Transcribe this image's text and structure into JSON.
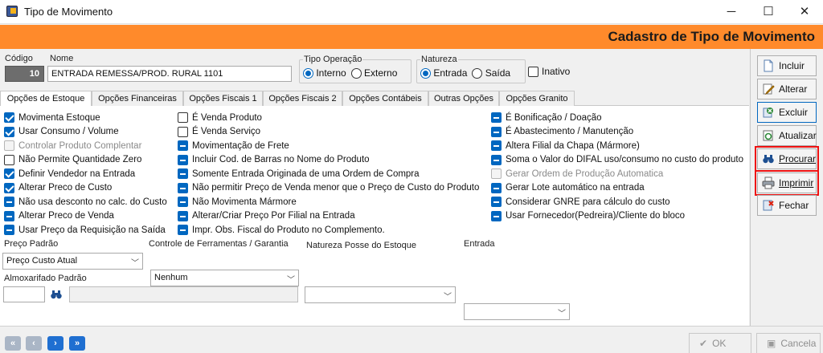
{
  "window": {
    "title": "Tipo de Movimento",
    "minimize": "─",
    "maximize": "☐",
    "close": "✕"
  },
  "banner": {
    "title": "Cadastro de Tipo de Movimento",
    "color": "#ff8a2b"
  },
  "header": {
    "codigo_label": "Código",
    "codigo_value": "10",
    "nome_label": "Nome",
    "nome_value": "ENTRADA REMESSA/PROD. RURAL 1101",
    "tipo_operacao_label": "Tipo Operação",
    "tipo_operacao_options": [
      "Interno",
      "Externo"
    ],
    "tipo_operacao_selected": "Interno",
    "natureza_label": "Natureza",
    "natureza_options": [
      "Entrada",
      "Saída"
    ],
    "natureza_selected": "Entrada",
    "inativo_label": "Inativo"
  },
  "tabs": [
    "Opções de Estoque",
    "Opções Financeiras",
    "Opções Fiscais 1",
    "Opções Fiscais 2",
    "Opções Contábeis",
    "Outras Opções",
    "Opções Granito"
  ],
  "active_tab": "Opções de Estoque",
  "options": {
    "col1": [
      {
        "label": "Movimenta Estoque",
        "state": "checked"
      },
      {
        "label": "Usar Consumo / Volume",
        "state": "checked"
      },
      {
        "label": "Controlar Produto Complentar",
        "state": "disabled"
      },
      {
        "label": "Não Permite Quantidade Zero",
        "state": "unchecked"
      },
      {
        "label": "Definir Vendedor na Entrada",
        "state": "checked"
      },
      {
        "label": "Alterar Preco de Custo",
        "state": "checked"
      },
      {
        "label": "Não usa desconto no calc. do Custo",
        "state": "indeterminate"
      },
      {
        "label": "Alterar Preco de Venda",
        "state": "indeterminate"
      },
      {
        "label": "Usar Preço da Requisição na Saída",
        "state": "indeterminate"
      }
    ],
    "col2": [
      {
        "label": "É Venda Produto",
        "state": "unchecked"
      },
      {
        "label": "É Venda Serviço",
        "state": "unchecked"
      },
      {
        "label": "Movimentação de Frete",
        "state": "indeterminate"
      },
      {
        "label": "Incluir Cod. de Barras no Nome do Produto",
        "state": "indeterminate"
      },
      {
        "label": "Somente Entrada Originada de uma Ordem de Compra",
        "state": "indeterminate"
      },
      {
        "label": "Não permitir Preço de Venda menor que o Preço de Custo do Produto",
        "state": "indeterminate"
      },
      {
        "label": "Não Movimenta Mármore",
        "state": "indeterminate"
      },
      {
        "label": "Alterar/Criar Preço Por Filial na Entrada",
        "state": "indeterminate"
      },
      {
        "label": "Impr. Obs. Fiscal do Produto no Complemento.",
        "state": "indeterminate"
      }
    ],
    "col3": [
      {
        "label": "É Bonificação / Doação",
        "state": "indeterminate"
      },
      {
        "label": "É Abastecimento / Manutenção",
        "state": "indeterminate"
      },
      {
        "label": "Altera Filial da Chapa (Mármore)",
        "state": "indeterminate"
      },
      {
        "label": "Soma o Valor do DIFAL uso/consumo no custo do produto",
        "state": "indeterminate"
      },
      {
        "label": "Gerar Ordem de Produção Automatica",
        "state": "disabled"
      },
      {
        "label": "Gerar Lote automático na entrada",
        "state": "indeterminate"
      },
      {
        "label": "Considerar GNRE para cálculo do custo",
        "state": "indeterminate"
      },
      {
        "label": "Usar Fornecedor(Pedreira)/Cliente do bloco",
        "state": "indeterminate"
      }
    ]
  },
  "combos": {
    "preco_padrao_label": "Preço Padrão",
    "preco_padrao_value": "Preço Custo Atual",
    "controle_label": "Controle de Ferramentas / Garantia",
    "controle_value": "Nenhum",
    "natureza_posse_label": "Natureza Posse do Estoque",
    "natureza_posse_value": "",
    "entrada_label": "Entrada",
    "entrada_value": ""
  },
  "almoxarifado": {
    "label": "Almoxarifado Padrão",
    "code": "",
    "name": ""
  },
  "sidebar": [
    {
      "label": "Incluir",
      "icon": "document-new-icon"
    },
    {
      "label": "Alterar",
      "icon": "edit-pencil-icon"
    },
    {
      "label": "Excluir",
      "icon": "delete-icon"
    },
    {
      "label": "Atualizar",
      "icon": "refresh-icon"
    },
    {
      "label": "Procurar",
      "icon": "binoculars-icon"
    },
    {
      "label": "Imprimir",
      "icon": "printer-icon"
    },
    {
      "label": "Fechar",
      "icon": "close-door-icon"
    }
  ],
  "footer": {
    "ok_label": "OK",
    "cancel_label": "Cancela",
    "nav": [
      "«",
      "‹",
      "›",
      "»"
    ]
  },
  "colors": {
    "accent": "#0067c0",
    "highlight": "#e11111"
  }
}
